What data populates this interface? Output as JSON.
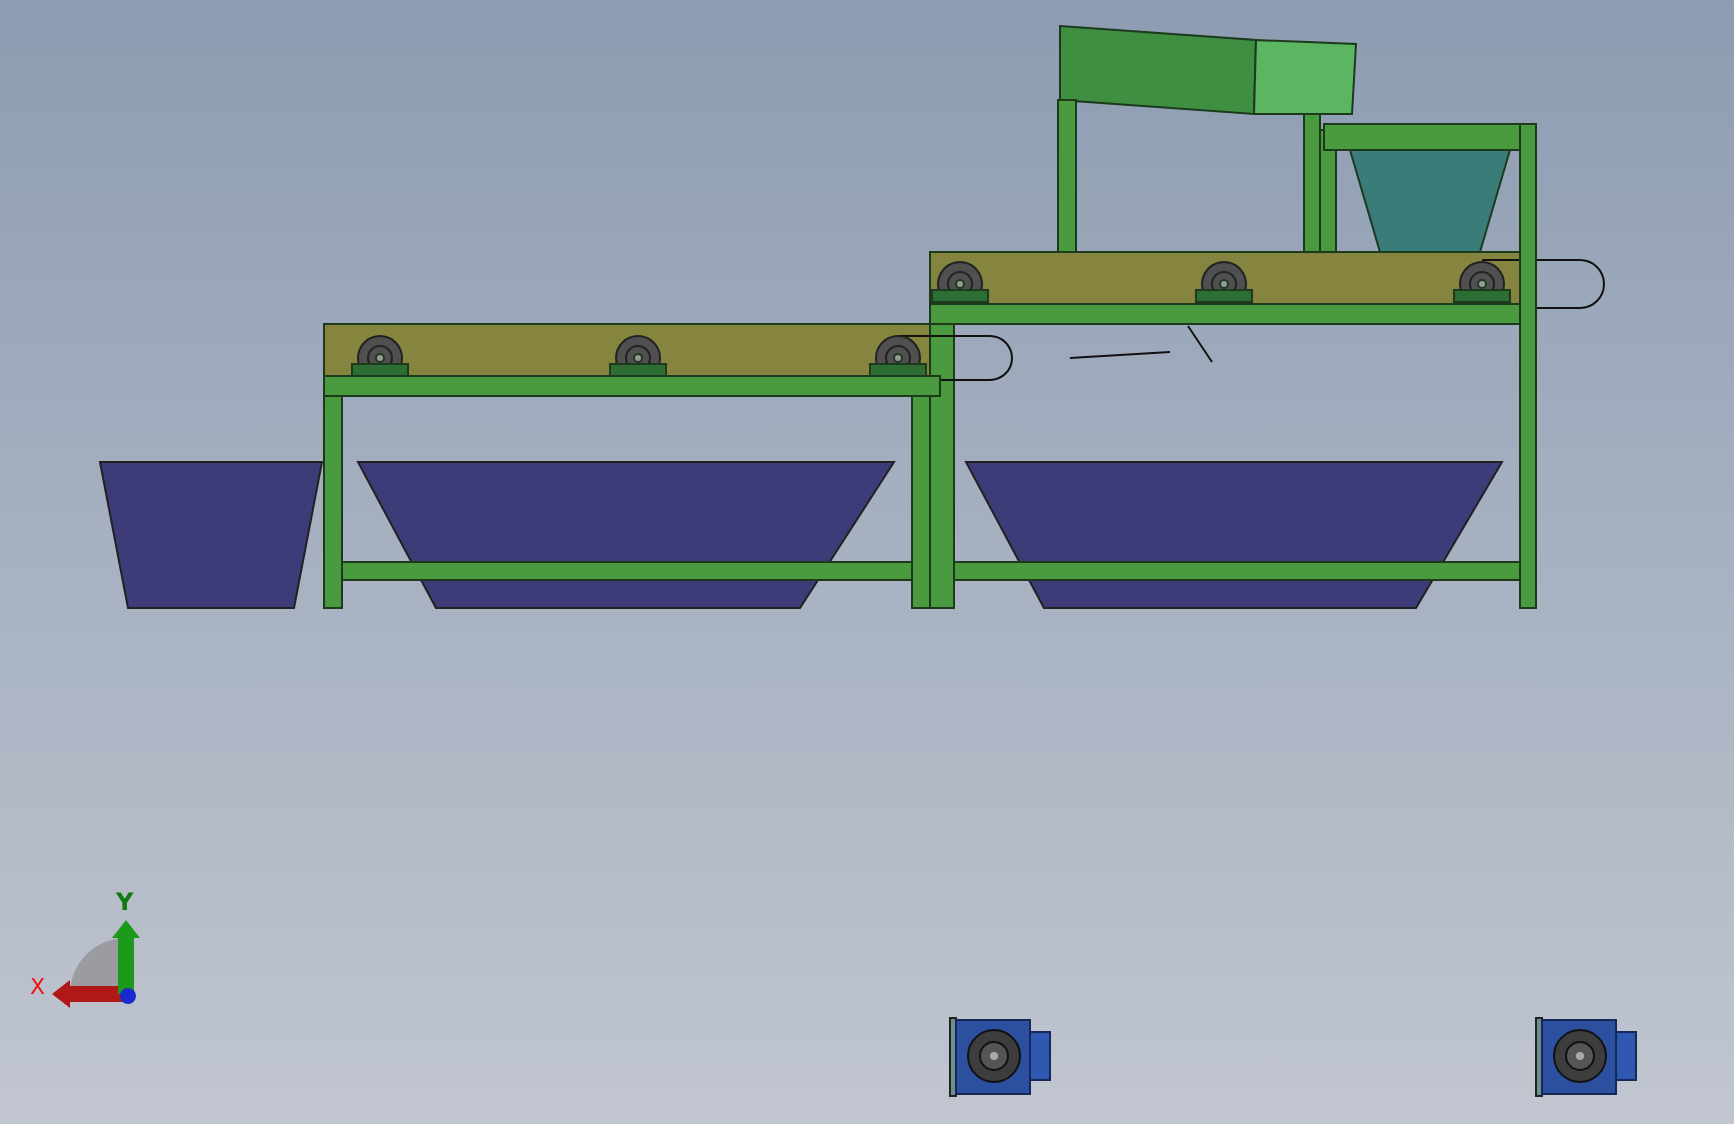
{
  "triad": {
    "y_label": "Y",
    "x_label": "X"
  }
}
